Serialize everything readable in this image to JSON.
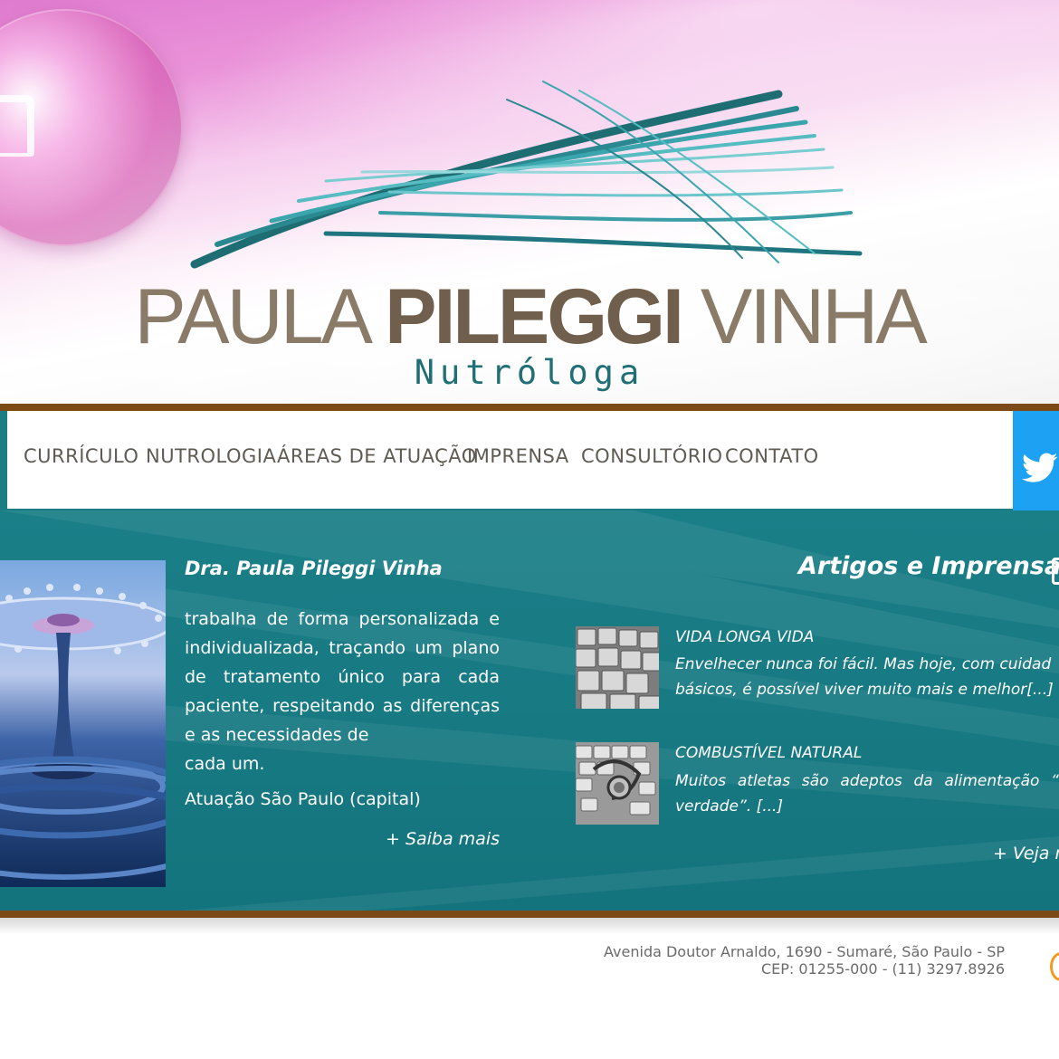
{
  "header": {
    "logo_part1": "PAULA ",
    "logo_part2": "PILEGGI",
    "logo_part3": " VINHA",
    "logo_subtitle": "Nutróloga"
  },
  "nav": {
    "items": [
      "CURRÍCULO",
      "NUTROLOGIA",
      "ÁREAS DE ATUAÇÃO",
      "IMPRENSA",
      "CONSULTÓRIO",
      "CONTATO"
    ],
    "twitter_icon": "twitter-icon"
  },
  "intro": {
    "title": "Dra. Paula Pileggi Vinha",
    "text_lines": [
      "trabalha de forma personalizada e",
      "individualizada, traçando um plano",
      "de tratamento único para cada",
      "paciente, respeitando as diferenças",
      "e as necessidades de",
      "cada um."
    ],
    "location": "Atuação São Paulo (capital)",
    "more_link": "+ Saiba mais"
  },
  "articles": {
    "section_title": "Artigos e Imprensa",
    "items": [
      {
        "title": "VIDA LONGA VIDA",
        "line1": "Envelhecer nunca foi fácil. Mas hoje, com cuidad",
        "line2": "básicos, é possível viver muito mais e melhor[...]"
      },
      {
        "title": "COMBUSTÍVEL NATURAL",
        "line1": "Muitos atletas são adeptos da alimentação “",
        "line2": "verdade”. [...]"
      }
    ],
    "more_link": "+ Veja m"
  },
  "footer": {
    "address_line1": "Avenida Doutor Arnaldo, 1690 - Sumaré, São Paulo - SP",
    "address_line2": "CEP: 01255-000 - (11) 3297.8926"
  },
  "colors": {
    "teal": "#1a7d83",
    "brown_bar": "#7b4a16",
    "twitter": "#1da1f2",
    "nav_text": "#5f5b53"
  }
}
